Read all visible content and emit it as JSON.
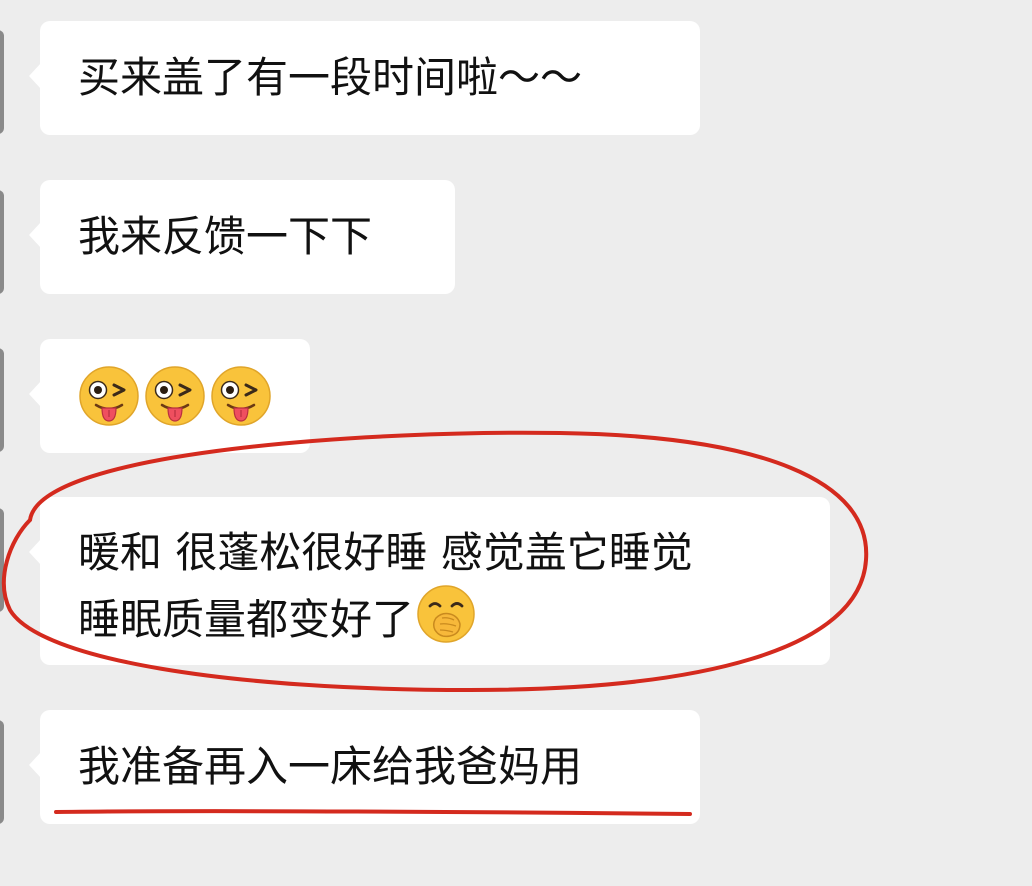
{
  "messages": [
    {
      "type": "text",
      "text": "买来盖了有一段时间啦～～"
    },
    {
      "type": "text",
      "text": "我来反馈一下下"
    },
    {
      "type": "emoji",
      "emojis": [
        "winking-tongue-face",
        "winking-tongue-face",
        "winking-tongue-face"
      ]
    },
    {
      "type": "text-multiline",
      "lines": [
        "暖和 很蓬松很好睡 感觉盖它睡觉",
        "睡眠质量都变好了"
      ],
      "trailing_emoji": "hand-over-mouth-face"
    },
    {
      "type": "text",
      "text": "我准备再入一床给我爸妈用"
    }
  ],
  "annotations": {
    "circle_color": "#d42a1e",
    "underline_color": "#d42a1e"
  },
  "colors": {
    "background": "#ededed",
    "bubble": "#ffffff",
    "text": "#111111"
  }
}
